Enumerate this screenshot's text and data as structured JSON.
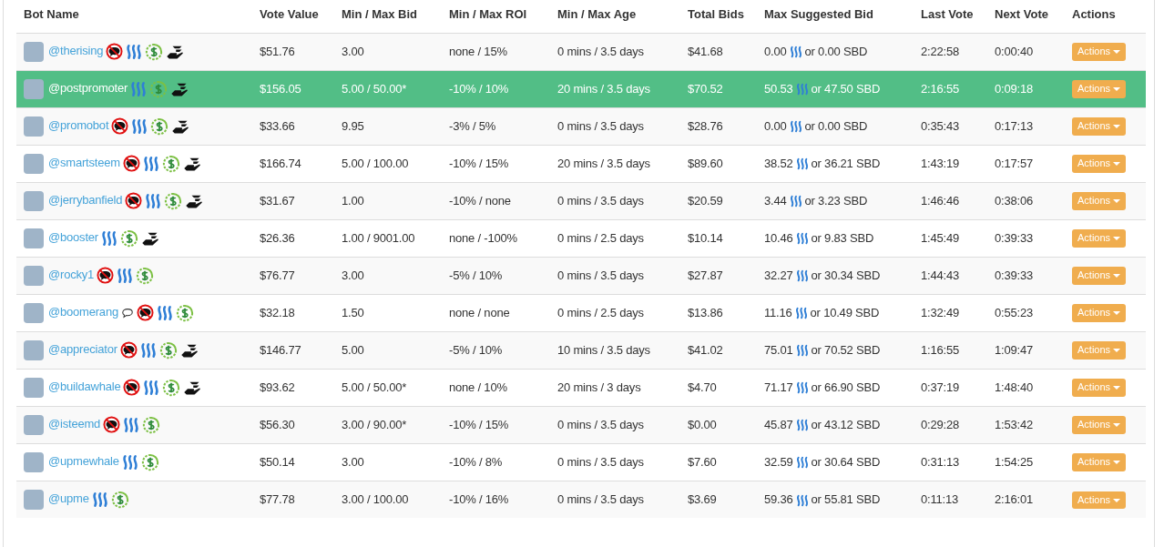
{
  "table": {
    "columns": [
      "Bot Name",
      "Vote Value",
      "Min / Max Bid",
      "Min / Max ROI",
      "Min / Max Age",
      "Total Bids",
      "Max Suggested Bid",
      "Last Vote",
      "Next Vote",
      "Actions"
    ],
    "rows": [
      {
        "name": "@therising",
        "comment_icon": false,
        "no_comment_icon": true,
        "steem_icon": true,
        "refund_icon": true,
        "hand_icon": true,
        "highlighted": false,
        "vote_value": "$51.76",
        "bid": "3.00",
        "roi": "none / 15%",
        "age": "0 mins / 3.5 days",
        "total_bids": "$41.68",
        "max_bid_steem": "0.00",
        "max_bid_sbd": "or 0.00 SBD",
        "last_vote": "2:22:58",
        "next_vote": "0:00:40",
        "action": "Actions"
      },
      {
        "name": "@postpromoter",
        "comment_icon": false,
        "no_comment_icon": false,
        "steem_icon": true,
        "refund_icon": true,
        "hand_icon": true,
        "highlighted": true,
        "vote_value": "$156.05",
        "bid": "5.00 / 50.00*",
        "roi": "-10% / 10%",
        "age": "20 mins / 3.5 days",
        "total_bids": "$70.52",
        "max_bid_steem": "50.53",
        "max_bid_sbd": "or 47.50 SBD",
        "last_vote": "2:16:55",
        "next_vote": "0:09:18",
        "action": "Actions"
      },
      {
        "name": "@promobot",
        "comment_icon": false,
        "no_comment_icon": true,
        "steem_icon": true,
        "refund_icon": true,
        "hand_icon": true,
        "highlighted": false,
        "vote_value": "$33.66",
        "bid": "9.95",
        "roi": "-3% / 5%",
        "age": "0 mins / 3.5 days",
        "total_bids": "$28.76",
        "max_bid_steem": "0.00",
        "max_bid_sbd": "or 0.00 SBD",
        "last_vote": "0:35:43",
        "next_vote": "0:17:13",
        "action": "Actions"
      },
      {
        "name": "@smartsteem",
        "comment_icon": false,
        "no_comment_icon": true,
        "steem_icon": true,
        "refund_icon": true,
        "hand_icon": true,
        "highlighted": false,
        "vote_value": "$166.74",
        "bid": "5.00 / 100.00",
        "roi": "-10% / 15%",
        "age": "20 mins / 3.5 days",
        "total_bids": "$89.60",
        "max_bid_steem": "38.52",
        "max_bid_sbd": "or 36.21 SBD",
        "last_vote": "1:43:19",
        "next_vote": "0:17:57",
        "action": "Actions"
      },
      {
        "name": "@jerrybanfield",
        "comment_icon": false,
        "no_comment_icon": true,
        "steem_icon": true,
        "refund_icon": true,
        "hand_icon": true,
        "highlighted": false,
        "vote_value": "$31.67",
        "bid": "1.00",
        "roi": "-10% / none",
        "age": "0 mins / 3.5 days",
        "total_bids": "$20.59",
        "max_bid_steem": "3.44",
        "max_bid_sbd": "or 3.23 SBD",
        "last_vote": "1:46:46",
        "next_vote": "0:38:06",
        "action": "Actions"
      },
      {
        "name": "@booster",
        "comment_icon": false,
        "no_comment_icon": false,
        "steem_icon": true,
        "refund_icon": true,
        "hand_icon": true,
        "highlighted": false,
        "vote_value": "$26.36",
        "bid": "1.00 / 9001.00",
        "roi": "none / -100%",
        "age": "0 mins / 2.5 days",
        "total_bids": "$10.14",
        "max_bid_steem": "10.46",
        "max_bid_sbd": "or 9.83 SBD",
        "last_vote": "1:45:49",
        "next_vote": "0:39:33",
        "action": "Actions"
      },
      {
        "name": "@rocky1",
        "comment_icon": false,
        "no_comment_icon": true,
        "steem_icon": true,
        "refund_icon": true,
        "hand_icon": false,
        "highlighted": false,
        "vote_value": "$76.77",
        "bid": "3.00",
        "roi": "-5% / 10%",
        "age": "0 mins / 3.5 days",
        "total_bids": "$27.87",
        "max_bid_steem": "32.27",
        "max_bid_sbd": "or 30.34 SBD",
        "last_vote": "1:44:43",
        "next_vote": "0:39:33",
        "action": "Actions"
      },
      {
        "name": "@boomerang",
        "comment_icon": true,
        "no_comment_icon": true,
        "steem_icon": true,
        "refund_icon": true,
        "hand_icon": false,
        "highlighted": false,
        "vote_value": "$32.18",
        "bid": "1.50",
        "roi": "none / none",
        "age": "0 mins / 2.5 days",
        "total_bids": "$13.86",
        "max_bid_steem": "11.16",
        "max_bid_sbd": "or 10.49 SBD",
        "last_vote": "1:32:49",
        "next_vote": "0:55:23",
        "action": "Actions"
      },
      {
        "name": "@appreciator",
        "comment_icon": false,
        "no_comment_icon": true,
        "steem_icon": true,
        "refund_icon": true,
        "hand_icon": true,
        "highlighted": false,
        "vote_value": "$146.77",
        "bid": "5.00",
        "roi": "-5% / 10%",
        "age": "10 mins / 3.5 days",
        "total_bids": "$41.02",
        "max_bid_steem": "75.01",
        "max_bid_sbd": "or 70.52 SBD",
        "last_vote": "1:16:55",
        "next_vote": "1:09:47",
        "action": "Actions"
      },
      {
        "name": "@buildawhale",
        "comment_icon": false,
        "no_comment_icon": true,
        "steem_icon": true,
        "refund_icon": true,
        "hand_icon": true,
        "highlighted": false,
        "vote_value": "$93.62",
        "bid": "5.00 / 50.00*",
        "roi": "none / 10%",
        "age": "20 mins / 3 days",
        "total_bids": "$4.70",
        "max_bid_steem": "71.17",
        "max_bid_sbd": "or 66.90 SBD",
        "last_vote": "0:37:19",
        "next_vote": "1:48:40",
        "action": "Actions"
      },
      {
        "name": "@isteemd",
        "comment_icon": false,
        "no_comment_icon": true,
        "steem_icon": true,
        "refund_icon": true,
        "hand_icon": false,
        "highlighted": false,
        "vote_value": "$56.30",
        "bid": "3.00 / 90.00*",
        "roi": "-10% / 15%",
        "age": "0 mins / 3.5 days",
        "total_bids": "$0.00",
        "max_bid_steem": "45.87",
        "max_bid_sbd": "or 43.12 SBD",
        "last_vote": "0:29:28",
        "next_vote": "1:53:42",
        "action": "Actions"
      },
      {
        "name": "@upmewhale",
        "comment_icon": false,
        "no_comment_icon": false,
        "steem_icon": true,
        "refund_icon": true,
        "hand_icon": false,
        "highlighted": false,
        "vote_value": "$50.14",
        "bid": "3.00",
        "roi": "-10% / 8%",
        "age": "0 mins / 3.5 days",
        "total_bids": "$7.60",
        "max_bid_steem": "32.59",
        "max_bid_sbd": "or 30.64 SBD",
        "last_vote": "0:31:13",
        "next_vote": "1:54:25",
        "action": "Actions"
      },
      {
        "name": "@upme",
        "comment_icon": false,
        "no_comment_icon": false,
        "steem_icon": true,
        "refund_icon": true,
        "hand_icon": false,
        "highlighted": false,
        "vote_value": "$77.78",
        "bid": "3.00 / 100.00",
        "roi": "-10% / 16%",
        "age": "0 mins / 3.5 days",
        "total_bids": "$3.69",
        "max_bid_steem": "59.36",
        "max_bid_sbd": "or 55.81 SBD",
        "last_vote": "0:11:13",
        "next_vote": "2:16:01",
        "action": "Actions"
      }
    ]
  }
}
